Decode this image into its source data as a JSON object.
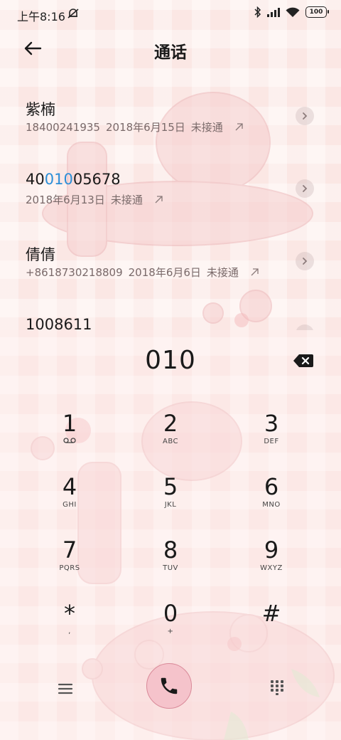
{
  "status_bar": {
    "time": "上午8:16",
    "battery": "100"
  },
  "header": {
    "title": "通话"
  },
  "calls": [
    {
      "name": "紫楠",
      "number": "18400241935",
      "date": "2018年6月15日",
      "status": "未接通"
    },
    {
      "name_prefix": "40",
      "name_match": "010",
      "name_suffix": "05678",
      "number": "",
      "date": "2018年6月13日",
      "status": "未接通"
    },
    {
      "name": "倩倩",
      "number": "+8618730218809",
      "date": "2018年6月6日",
      "status": "未接通"
    },
    {
      "name": "1008611"
    }
  ],
  "dialpad": {
    "input": "010",
    "keys": [
      {
        "digit": "1",
        "letters": ""
      },
      {
        "digit": "2",
        "letters": "ABC"
      },
      {
        "digit": "3",
        "letters": "DEF"
      },
      {
        "digit": "4",
        "letters": "GHI"
      },
      {
        "digit": "5",
        "letters": "JKL"
      },
      {
        "digit": "6",
        "letters": "MNO"
      },
      {
        "digit": "7",
        "letters": "PQRS"
      },
      {
        "digit": "8",
        "letters": "TUV"
      },
      {
        "digit": "9",
        "letters": "WXYZ"
      },
      {
        "digit": "*",
        "letters": ","
      },
      {
        "digit": "0",
        "letters": "+"
      },
      {
        "digit": "#",
        "letters": ""
      }
    ]
  },
  "colors": {
    "highlight": "#2c8fd8",
    "call_button": "#f5c3cb",
    "background": "#fbe7e4"
  },
  "icons": {
    "back": "arrow-left-icon",
    "backspace": "backspace-icon",
    "menu": "hamburger-menu-icon",
    "call": "phone-icon",
    "keypad": "keypad-grid-icon",
    "voicemail": "voicemail-icon",
    "outgoing": "outgoing-arrow-icon",
    "detail": "chevron-right-icon"
  }
}
